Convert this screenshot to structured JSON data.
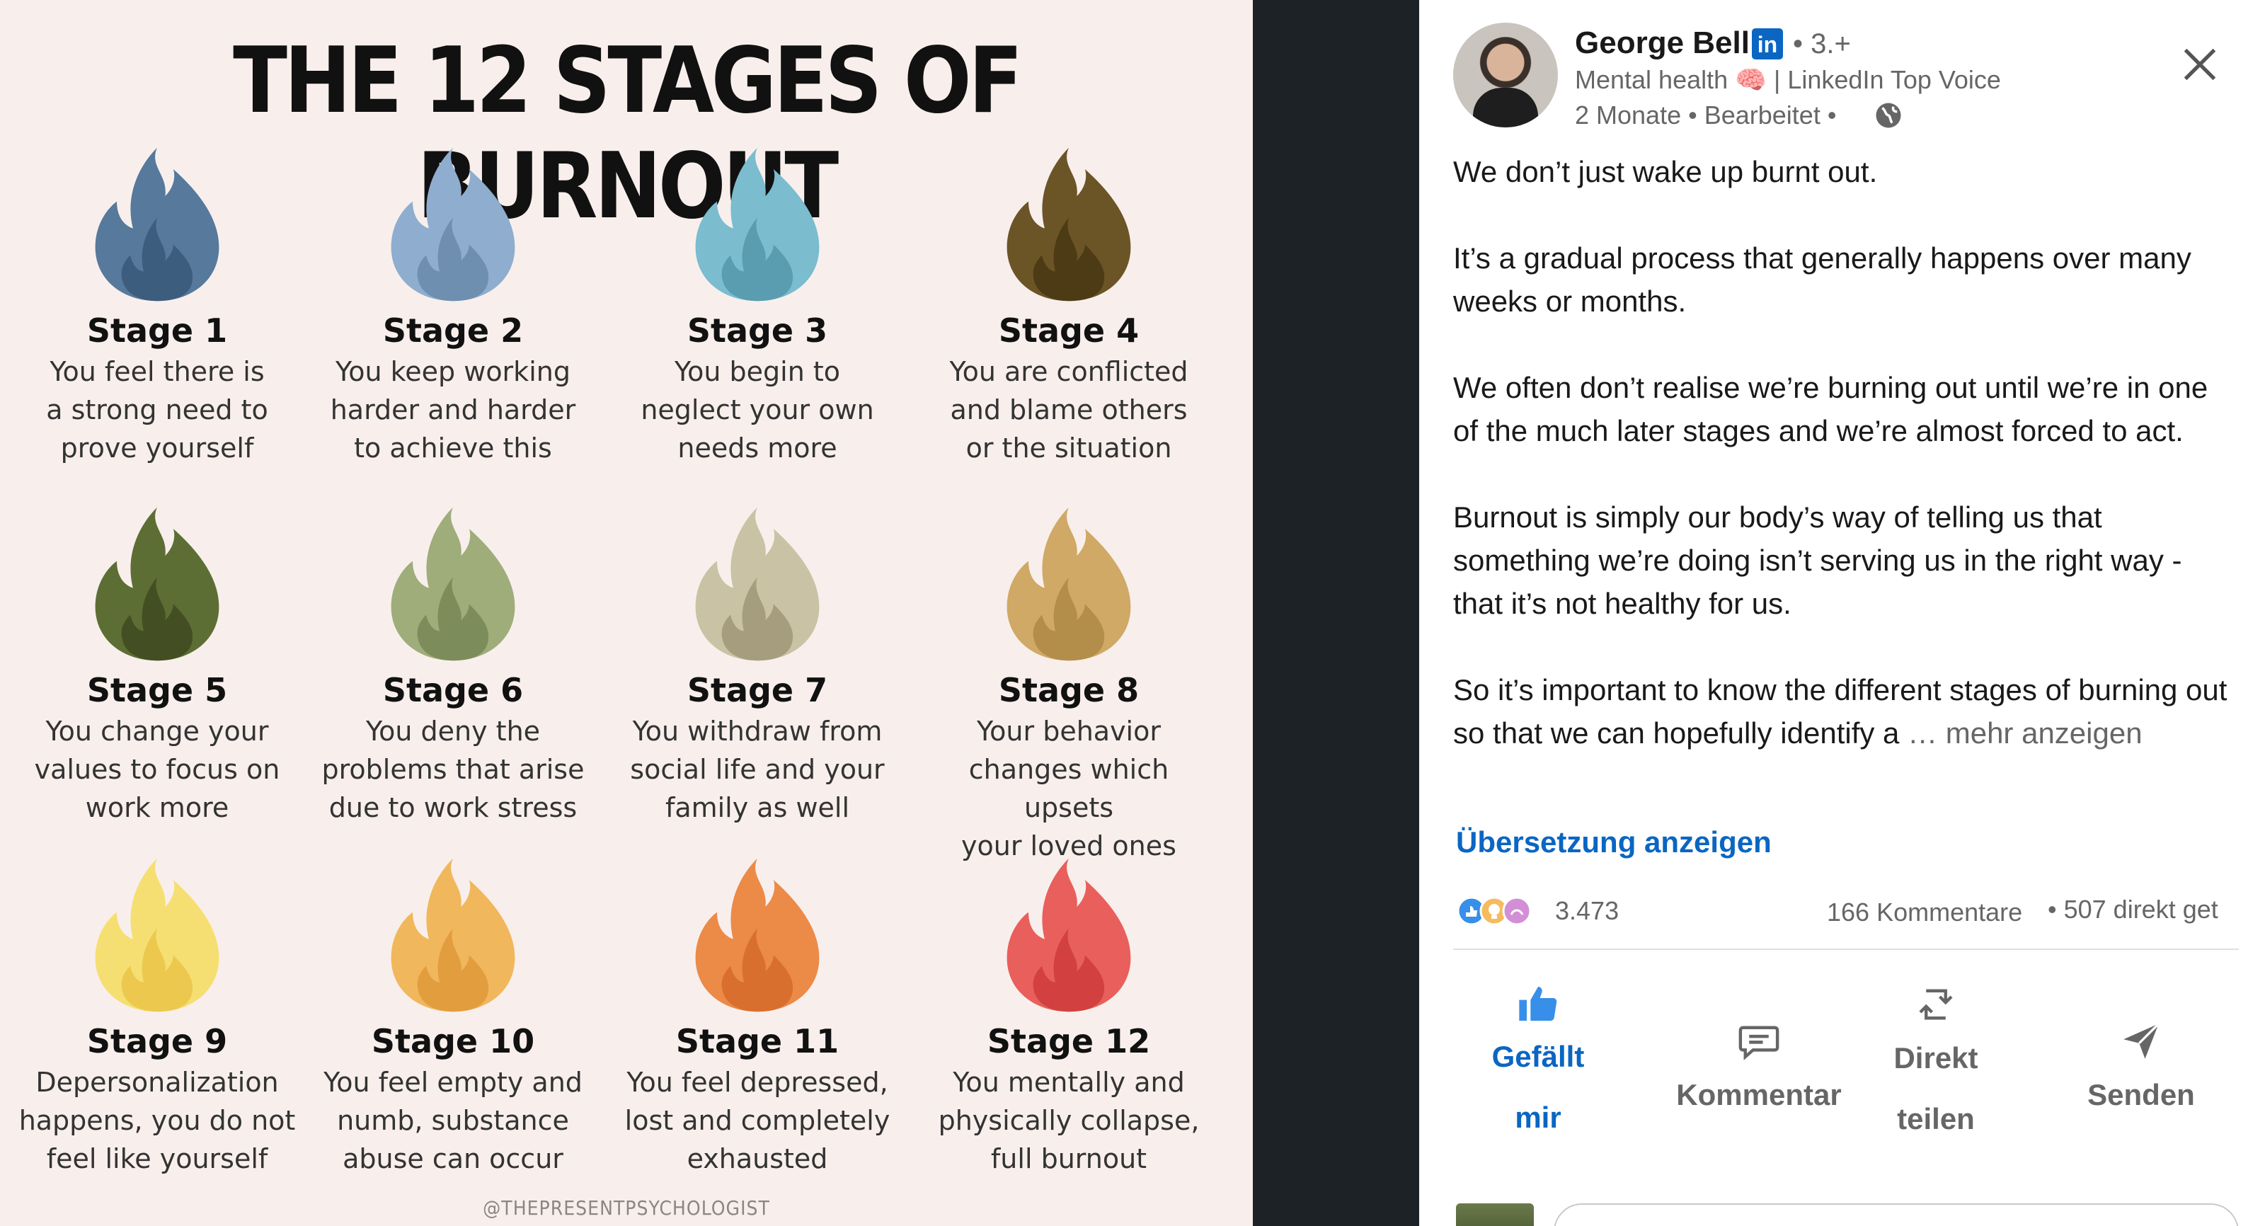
{
  "infographic": {
    "title": "THE 12 STAGES OF BURNOUT",
    "credit": "@THEPRESENTPSYCHOLOGIST",
    "stages": [
      {
        "name": "Stage 1",
        "desc": "You feel there is\na strong need to\nprove yourself",
        "color_outer": "#56799c",
        "color_inner": "#3d5d7f"
      },
      {
        "name": "Stage 2",
        "desc": "You keep working\nharder and harder\nto achieve this",
        "color_outer": "#8fadce",
        "color_inner": "#6e8fb0"
      },
      {
        "name": "Stage 3",
        "desc": "You begin to\nneglect your own\nneeds more",
        "color_outer": "#7bbccf",
        "color_inner": "#5a9db0"
      },
      {
        "name": "Stage 4",
        "desc": "You are conflicted\nand blame others\nor the situation",
        "color_outer": "#6b5426",
        "color_inner": "#4d3b16"
      },
      {
        "name": "Stage 5",
        "desc": "You change your\nvalues to focus on\nwork more",
        "color_outer": "#5d6e34",
        "color_inner": "#434f22"
      },
      {
        "name": "Stage 6",
        "desc": "You deny the\nproblems that arise\ndue to work stress",
        "color_outer": "#9ead7a",
        "color_inner": "#7d8c5b"
      },
      {
        "name": "Stage 7",
        "desc": "You withdraw from\nsocial life and your\nfamily as well",
        "color_outer": "#c9c2a4",
        "color_inner": "#a59d7e"
      },
      {
        "name": "Stage 8",
        "desc": "Your behavior\nchanges which upsets\nyour loved ones",
        "color_outer": "#cfa965",
        "color_inner": "#b38d4a"
      },
      {
        "name": "Stage 9",
        "desc": "Depersonalization\nhappens, you do not\nfeel like yourself",
        "color_outer": "#f6df72",
        "color_inner": "#ecc94e"
      },
      {
        "name": "Stage 10",
        "desc": "You feel empty and\nnumb, substance\nabuse can occur",
        "color_outer": "#f1b75c",
        "color_inner": "#e29d3e"
      },
      {
        "name": "Stage 11",
        "desc": "You feel depressed,\nlost and completely\nexhausted",
        "color_outer": "#ec8a48",
        "color_inner": "#d96f2e"
      },
      {
        "name": "Stage 12",
        "desc": "You mentally and\nphysically collapse,\nfull burnout",
        "color_outer": "#e85f5c",
        "color_inner": "#d2413f"
      }
    ]
  },
  "post": {
    "author": {
      "name": "George Bell",
      "badge": "in",
      "connection": "• 3.+",
      "headline": "Mental health",
      "headline_emoji": "🧠",
      "headline_suffix": "| LinkedIn Top Voice",
      "meta": "2 Monate • Bearbeitet •"
    },
    "body": [
      "We don’t just wake up burnt out.",
      "It’s a gradual process that generally happens over many weeks or months.",
      "We often don’t realise we’re burning out until we’re in one of the much later stages and we’re almost forced to act.",
      "Burnout is simply our body’s way of telling us that something we’re doing isn’t serving us in the right way - that it’s not healthy for us.",
      "So it’s important to know the different stages of burning out so that we can hopefully identify a"
    ],
    "more_label": "… mehr anzeigen",
    "translate_label": "Übersetzung anzeigen",
    "reaction_count": "3.473",
    "comment_count": "166 Kommentare",
    "share_count": "• 507 direkt get",
    "actions": {
      "like": "Gefällt mir",
      "comment": "Kommentar",
      "share": "Direkt teilen",
      "send": "Senden"
    },
    "colors": {
      "accent": "#0a66c2",
      "muted": "#666666"
    }
  }
}
